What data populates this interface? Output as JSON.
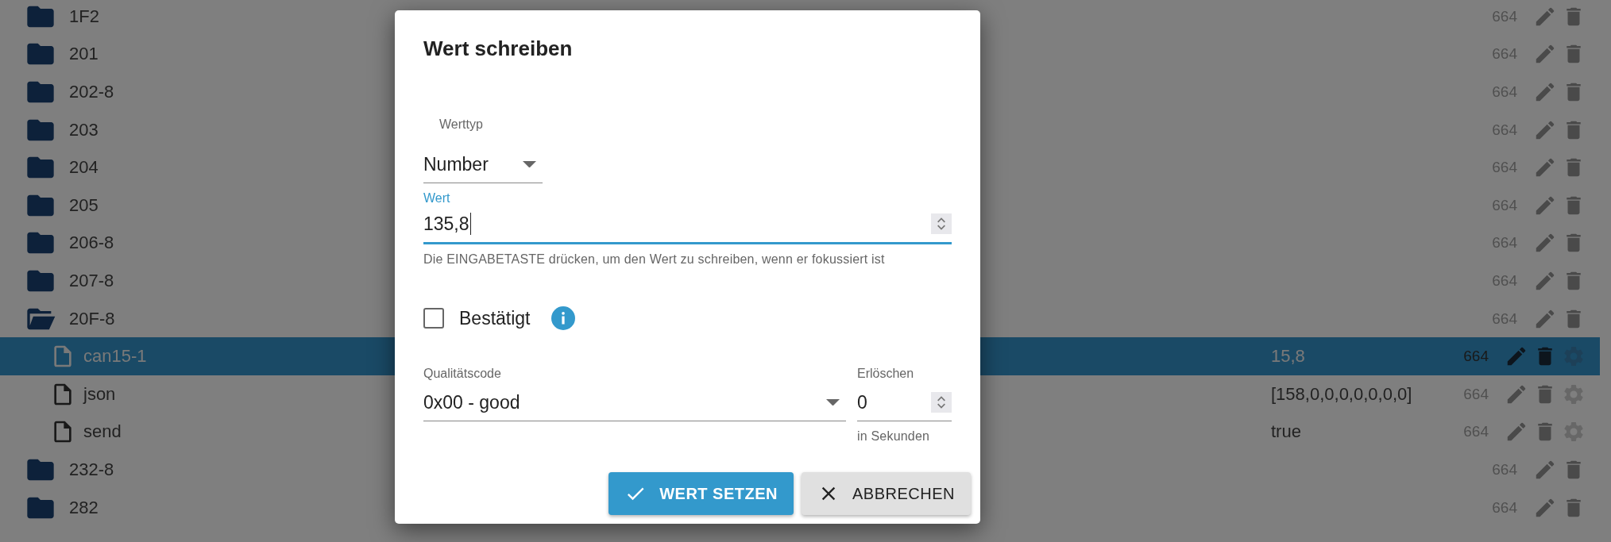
{
  "tree": {
    "rows": [
      {
        "kind": "folder",
        "name": "1F2",
        "rights": "664",
        "expanded": false,
        "selected": false
      },
      {
        "kind": "folder",
        "name": "201",
        "rights": "664",
        "expanded": false,
        "selected": false
      },
      {
        "kind": "folder",
        "name": "202-8",
        "rights": "664",
        "expanded": false,
        "selected": false
      },
      {
        "kind": "folder",
        "name": "203",
        "rights": "664",
        "expanded": false,
        "selected": false
      },
      {
        "kind": "folder",
        "name": "204",
        "rights": "664",
        "expanded": false,
        "selected": false
      },
      {
        "kind": "folder",
        "name": "205",
        "rights": "664",
        "expanded": false,
        "selected": false
      },
      {
        "kind": "folder",
        "name": "206-8",
        "rights": "664",
        "expanded": false,
        "selected": false
      },
      {
        "kind": "folder",
        "name": "207-8",
        "rights": "664",
        "expanded": false,
        "selected": false
      },
      {
        "kind": "folder",
        "name": "20F-8",
        "rights": "664",
        "expanded": true,
        "selected": false,
        "children": [
          {
            "kind": "file",
            "name": "can15-1",
            "value": "15,8",
            "rights": "664",
            "selected": true
          },
          {
            "kind": "file",
            "name": "json",
            "value": "[158,0,0,0,0,0,0,0]",
            "rights": "664",
            "selected": false
          },
          {
            "kind": "file",
            "name": "send",
            "value": "true",
            "rights": "664",
            "selected": false
          }
        ]
      },
      {
        "kind": "folder",
        "name": "232-8",
        "rights": "664",
        "expanded": false,
        "selected": false
      },
      {
        "kind": "folder",
        "name": "282",
        "rights": "664",
        "expanded": false,
        "selected": false
      }
    ]
  },
  "dialog": {
    "title": "Wert schreiben",
    "value_type": {
      "label": "Werttyp",
      "value": "Number"
    },
    "value": {
      "label": "Wert",
      "value": "135,8",
      "focused": true,
      "helper": "Die EINGABETASTE drücken, um den Wert zu schreiben, wenn er fokussiert ist"
    },
    "acknowledged": {
      "label": "Bestätigt",
      "checked": false
    },
    "quality": {
      "label": "Qualitätscode",
      "value": "0x00 - good"
    },
    "expire": {
      "label": "Erlöschen",
      "value": "0",
      "helper": "in Sekunden"
    },
    "buttons": [
      {
        "label": "WERT SETZEN",
        "kind": "primary"
      },
      {
        "label": "ABBRECHEN",
        "kind": "secondary"
      }
    ]
  }
}
